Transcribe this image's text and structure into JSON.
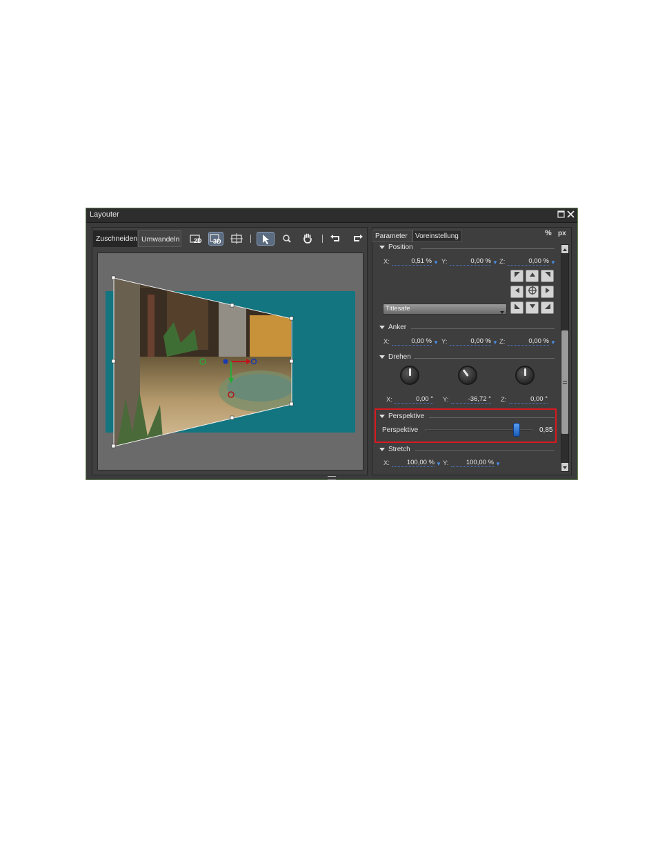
{
  "window": {
    "title": "Layouter"
  },
  "left_panel": {
    "tabs": [
      "Zuschneiden",
      "Umwandeln"
    ],
    "active_tab": "Umwandeln",
    "toolbar": [
      {
        "name": "2d-mode",
        "label": "2D"
      },
      {
        "name": "3d-mode",
        "label": "3D"
      },
      {
        "name": "fit-view",
        "label": ""
      },
      {
        "name": "select-tool",
        "label": ""
      },
      {
        "name": "zoom-tool",
        "label": ""
      },
      {
        "name": "hand-tool",
        "label": ""
      },
      {
        "name": "undo",
        "label": ""
      },
      {
        "name": "redo",
        "label": ""
      }
    ]
  },
  "right_panel": {
    "tabs": [
      "Parameter",
      "Voreinstellung"
    ],
    "units": [
      "%",
      "px"
    ],
    "position": {
      "label": "Position",
      "x_label": "X:",
      "x_value": "0,51 %",
      "y_label": "Y:",
      "y_value": "0,00 %",
      "z_label": "Z:",
      "z_value": "0,00 %",
      "preset_dropdown": "Titlesafe"
    },
    "anker": {
      "label": "Anker",
      "x_label": "X:",
      "x_value": "0,00 %",
      "y_label": "Y:",
      "y_value": "0,00 %",
      "z_label": "Z:",
      "z_value": "0,00 %"
    },
    "drehen": {
      "label": "Drehen",
      "x_label": "X:",
      "x_value": "0,00 °",
      "y_label": "Y:",
      "y_value": "-36,72 °",
      "z_label": "Z:",
      "z_value": "0,00 °",
      "knob_angles_deg": [
        0,
        -36.72,
        0
      ]
    },
    "perspektive": {
      "label": "Perspektive",
      "slider_label": "Perspektive",
      "value": "0,85",
      "slider_fraction": 0.85,
      "highlight_color": "#d9191f"
    },
    "stretch": {
      "label": "Stretch",
      "x_label": "X:",
      "x_value": "100,00 %",
      "y_label": "Y:",
      "y_value": "100,00 %"
    }
  },
  "colors": {
    "background_teal": "#127580",
    "panel_dark": "#3b3b3b",
    "canvas_gray": "#6a6a6a",
    "accent_blue": "#4a8ee8"
  }
}
